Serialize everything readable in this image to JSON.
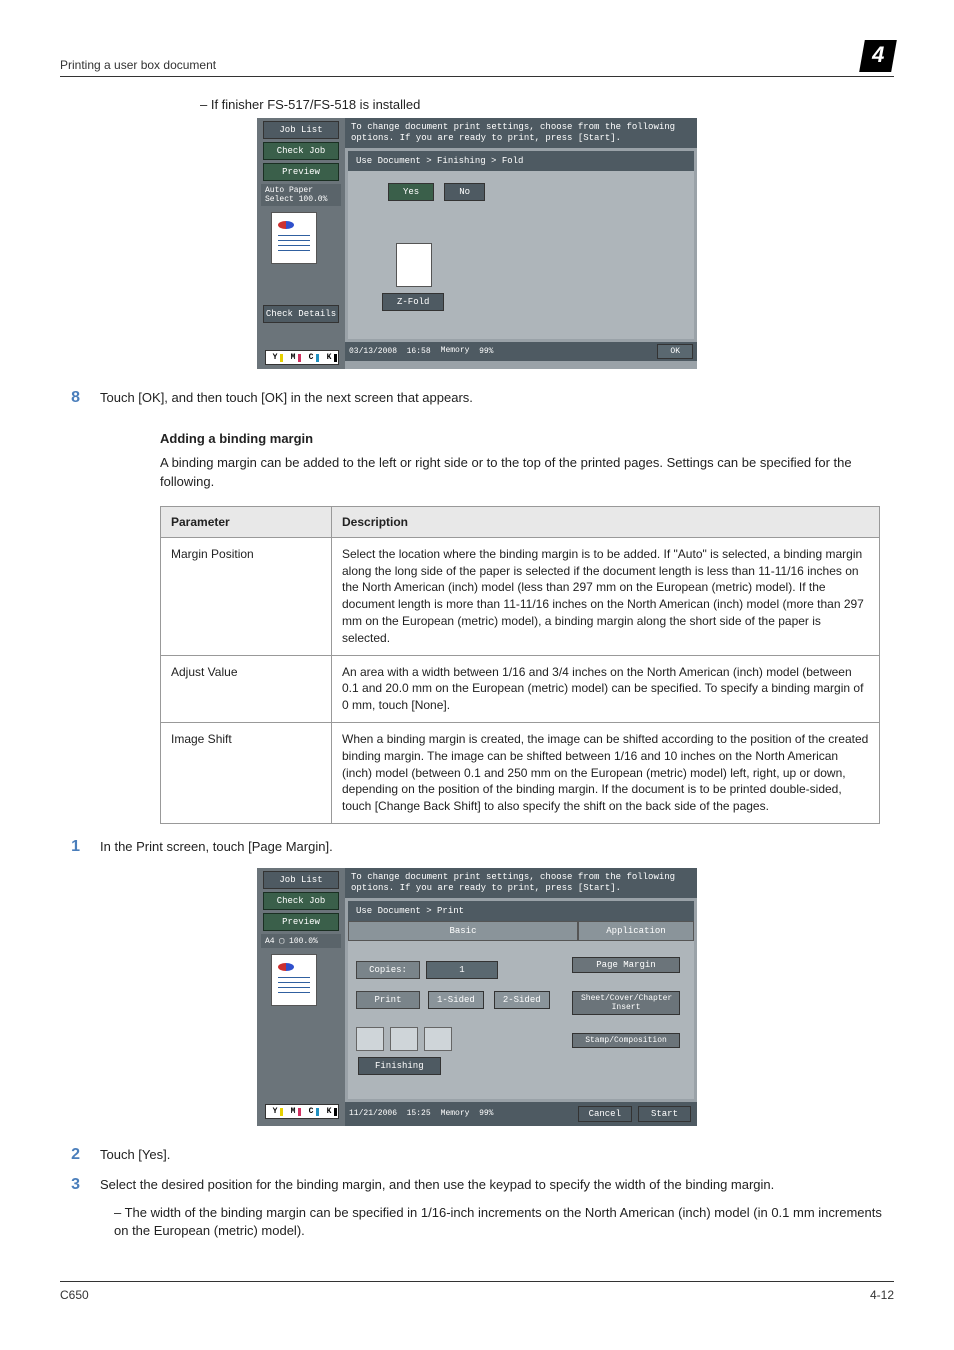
{
  "header": {
    "section": "Printing a user box document",
    "chapter": "4"
  },
  "intro_note": "–   If finisher FS-517/FS-518 is installed",
  "screenshot1": {
    "sidebar": {
      "job_list": "Job List",
      "check_job": "Check Job",
      "preview": "Preview",
      "check_details": "Check Details",
      "paper": "Auto Paper Select  100.0%"
    },
    "banner": "To change document print settings, choose from the following options. If you are ready to print, press [Start].",
    "breadcrumb": "Use Document > Finishing > Fold",
    "yes": "Yes",
    "no": "No",
    "zfold": "Z-Fold",
    "cmyk": {
      "y": "Y",
      "m": "M",
      "c": "C",
      "k": "K"
    },
    "footer": {
      "date": "03/13/2008",
      "time": "16:58",
      "memory": "Memory",
      "mem_val": "99%",
      "ok": "OK"
    }
  },
  "step8": {
    "num": "8",
    "text": "Touch [OK], and then touch [OK] in the next screen that appears."
  },
  "heading": "Adding a binding margin",
  "intro": "A binding margin can be added to the left or right side or to the top of the printed pages. Settings can be specified for the following.",
  "table": {
    "headers": {
      "param": "Parameter",
      "desc": "Description"
    },
    "rows": [
      {
        "param": "Margin Position",
        "desc": "Select the location where the binding margin is to be added. If \"Auto\" is selected, a binding margin along the long side of the paper is selected if the document length is less than 11-11/16 inches on the North American (inch) model (less than 297 mm on the European (metric) model). If the document length is more than 11-11/16 inches on the North American (inch) model (more than 297 mm on the European (metric) model), a binding margin along the short side of the paper is selected."
      },
      {
        "param": "Adjust Value",
        "desc": "An area with a width between 1/16 and 3/4 inches on the North American (inch) model (between 0.1 and 20.0 mm on the European (metric) model) can be specified. To specify a binding margin of 0 mm, touch [None]."
      },
      {
        "param": "Image Shift",
        "desc": "When a binding margin is created, the image can be shifted according to the position of the created binding margin. The image can be shifted between 1/16 and 10 inches on the North American (inch) model (between 0.1 and 250 mm on the European (metric) model) left, right, up or down, depending on the position of the binding margin. If the document is to be printed double-sided, touch [Change Back Shift] to also specify the shift on the back side of the pages."
      }
    ]
  },
  "step1": {
    "num": "1",
    "text": "In the Print screen, touch [Page Margin]."
  },
  "screenshot2": {
    "sidebar": {
      "job_list": "Job List",
      "check_job": "Check Job",
      "preview": "Preview",
      "paper": "A4 ▢  100.0%"
    },
    "banner": "To change document print settings, choose from the following options. If you are ready to print, press [Start].",
    "breadcrumb": "Use Document > Print",
    "tabs": {
      "basic": "Basic",
      "application": "Application"
    },
    "copies_label": "Copies:",
    "copies_val": "1",
    "print_label": "Print",
    "one_sided": "1-Sided",
    "two_sided": "2-Sided",
    "finishing": "Finishing",
    "app_btns": {
      "page_margin": "Page Margin",
      "sheet_cover": "Sheet/Cover/Chapter Insert",
      "stamp": "Stamp/Composition"
    },
    "footer": {
      "date": "11/21/2006",
      "time": "15:25",
      "memory": "Memory",
      "mem_val": "99%",
      "cancel": "Cancel",
      "start": "Start"
    }
  },
  "step2": {
    "num": "2",
    "text": "Touch [Yes]."
  },
  "step3": {
    "num": "3",
    "text": "Select the desired position for the binding margin, and then use the keypad to specify the width of the binding margin.",
    "sub": "–   The width of the binding margin can be specified in 1/16-inch increments on the North American (inch) model (in 0.1 mm increments on the European (metric) model)."
  },
  "footer": {
    "model": "C650",
    "page": "4-12"
  }
}
